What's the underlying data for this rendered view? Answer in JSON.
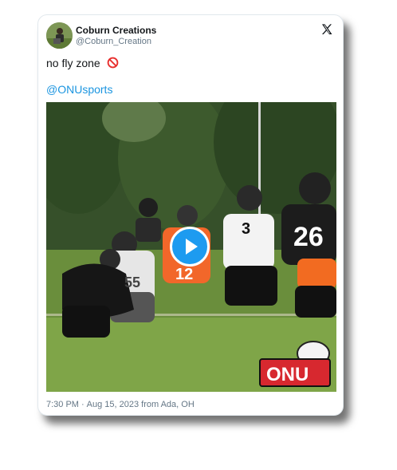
{
  "tweet": {
    "author_name": "Coburn Creations",
    "author_handle": "@Coburn_Creation",
    "text": "no fly zone",
    "emoji_icon": "no-entry-emoji",
    "mention": "@ONUsports",
    "time": "7:30 PM",
    "separator": "·",
    "date_location": "Aug 15, 2023 from Ada, OH"
  },
  "media": {
    "type": "video",
    "play_icon": "play-icon",
    "watermark_logo_text": "ONU",
    "players": [
      {
        "jersey": "26"
      },
      {
        "jersey": "3"
      },
      {
        "jersey": "12"
      },
      {
        "jersey": "55"
      }
    ]
  },
  "colors": {
    "link": "#1b95e0",
    "play_button": "#1d9bf0",
    "orange_jersey": "#f26b21",
    "black_jersey": "#1c1c1c"
  }
}
